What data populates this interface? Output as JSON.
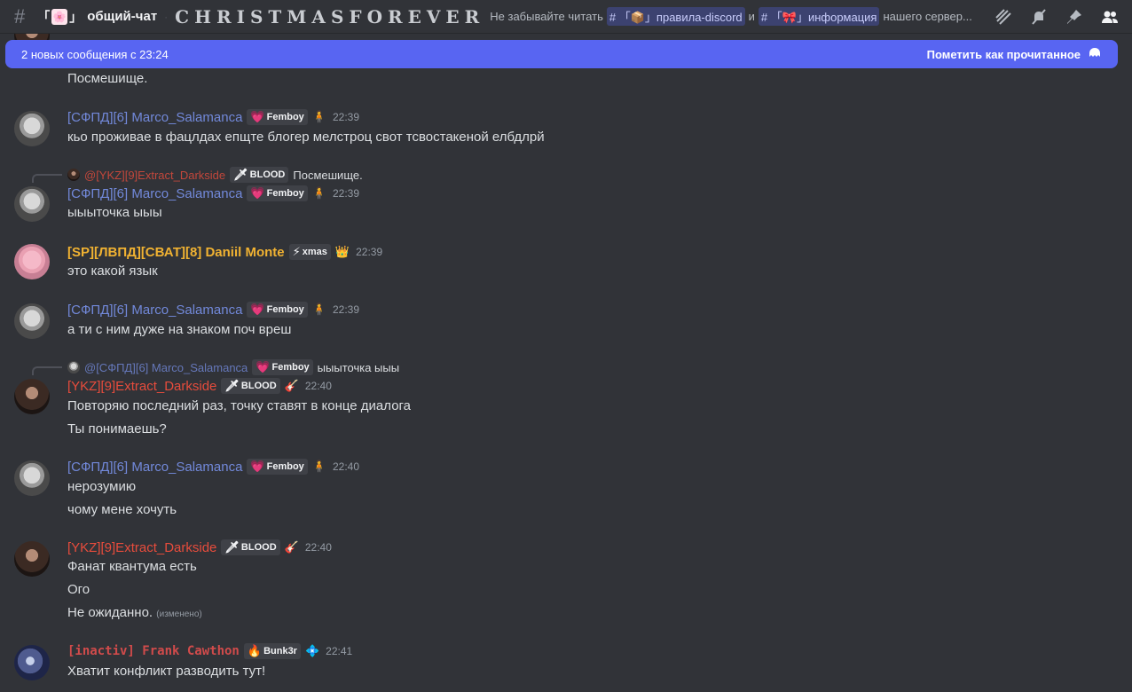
{
  "header": {
    "channel_prefix": "「",
    "channel_emoji": "🌸",
    "channel_suffix": "」",
    "channel_name": "общий-чат",
    "topic_fancy": "CHRISTMASFOREVER",
    "topic_text_1": "Не забывайте читать",
    "mention_1": "# 「📦」правила-discord",
    "topic_and": "и",
    "mention_2": "# 「🎀」информация",
    "topic_text_2": "нашего сервер..."
  },
  "new_messages_bar": {
    "left_text": "2 новых сообщения с 23:24",
    "right_text": "Пометить как прочитанное"
  },
  "messages": [
    {
      "lines": [
        "Посмешище."
      ]
    },
    {
      "author": "[СФПД][6] Marco_Salamanca",
      "badge": "Femboy",
      "badge_emoji": "💗",
      "extra_emoji": "🧍",
      "time": "22:39",
      "lines": [
        "кьо проживае в фацлдах епщте блогер мелстроц свот тсвостакеной елбдлрй"
      ]
    },
    {
      "reply_author": "@[YKZ][9]Extract_Darkside",
      "reply_badge": "BLOOD",
      "reply_badge_emoji": "🗡",
      "reply_text": "Посмешище.",
      "author": "[СФПД][6] Marco_Salamanca",
      "badge": "Femboy",
      "badge_emoji": "💗",
      "extra_emoji": "🧍",
      "time": "22:39",
      "lines": [
        "ыыыточка ыыы"
      ]
    },
    {
      "author": "[SP][ЛВПД][СВАТ][8] Daniil Monte",
      "badge": "xmas",
      "badge_emoji": "⚡",
      "extra_emoji": "👑",
      "time": "22:39",
      "lines": [
        "это какой язык"
      ]
    },
    {
      "author": "[СФПД][6] Marco_Salamanca",
      "badge": "Femboy",
      "badge_emoji": "💗",
      "extra_emoji": "🧍",
      "time": "22:39",
      "lines": [
        "а ти с ним дуже на знаком поч вреш"
      ]
    },
    {
      "reply_author": "@[СФПД][6] Marco_Salamanca",
      "reply_badge": "Femboy",
      "reply_badge_emoji": "💗",
      "reply_text": "ыыыточка ыыы",
      "author": "[YKZ][9]Extract_Darkside",
      "badge": "BLOOD",
      "badge_emoji": "🗡",
      "extra_emoji": "🎸",
      "time": "22:40",
      "lines": [
        "Повторяю последний раз, точку ставят в конце диалога",
        "Ты понимаешь?"
      ]
    },
    {
      "author": "[СФПД][6] Marco_Salamanca",
      "badge": "Femboy",
      "badge_emoji": "💗",
      "extra_emoji": "🧍",
      "time": "22:40",
      "lines": [
        "нерозумию",
        "чому мене хочуть"
      ]
    },
    {
      "author": "[YKZ][9]Extract_Darkside",
      "badge": "BLOOD",
      "badge_emoji": "🗡",
      "extra_emoji": "🎸",
      "time": "22:40",
      "lines": [
        "Фанат квантума есть",
        "Ого",
        "Не ожиданно."
      ],
      "edited": "(изменено)"
    },
    {
      "author": "[inactiv] Frank Cawthon",
      "badge": "Bunk3r",
      "badge_emoji": "🔥",
      "extra_emoji": "💠",
      "time": "22:41",
      "lines": [
        "Хватит конфликт разводить тут!"
      ]
    }
  ],
  "colors": {
    "accent": "#5865f2",
    "marco": "#7289da",
    "daniil": "#f0b232",
    "extract": "#e74c3c",
    "frank": "#d14b4b"
  }
}
